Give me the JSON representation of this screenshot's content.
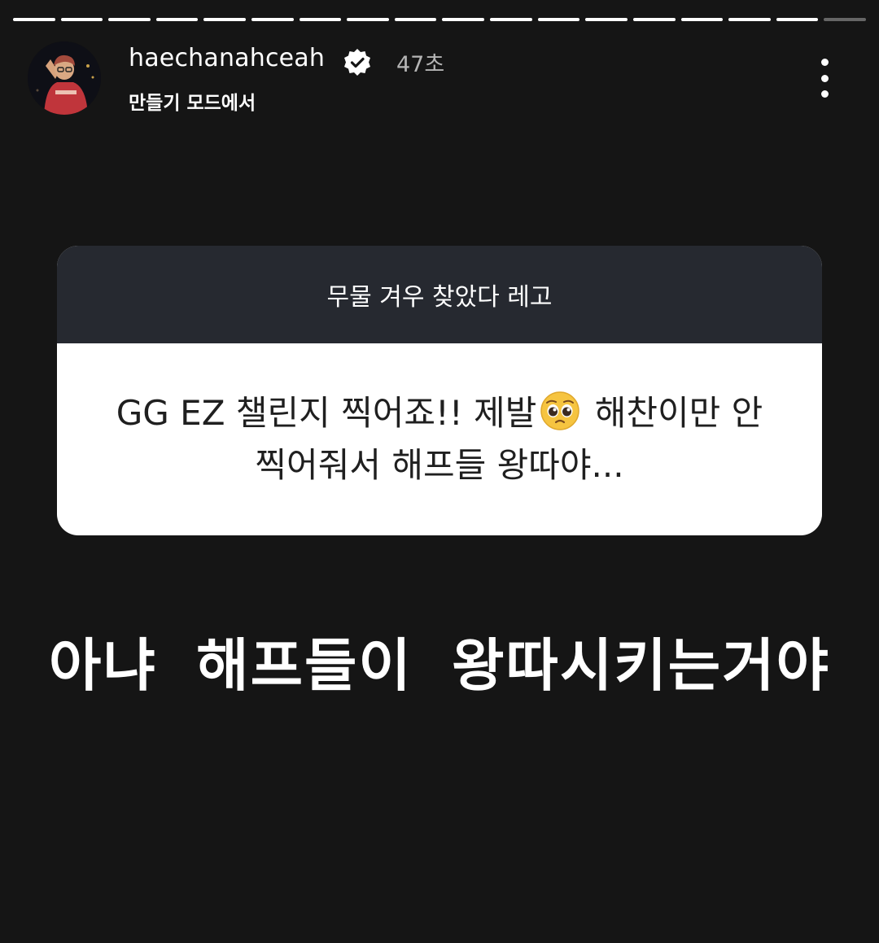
{
  "story": {
    "progress_segments": 18,
    "active_segment": 18
  },
  "header": {
    "username": "haechanahceah",
    "verified_icon": "verified-badge-icon",
    "time_ago": "47초",
    "subtitle": "만들기 모드에서",
    "more_icon": "more-vertical-icon"
  },
  "sticker": {
    "question": "무물 겨우 찾았다 레고",
    "answer_part1": "GG EZ 챌린지 찍어죠!! 제발",
    "answer_emoji": "pleading-face-emoji",
    "answer_part2": " 해찬이만 안 찍어줘서 해프들 왕따야...",
    "header_color": "#262930",
    "body_color": "#ffffff"
  },
  "caption": {
    "text": "아냐 해프들이 왕따시키는거야"
  },
  "colors": {
    "background": "#151515",
    "text": "#ffffff",
    "muted": "#b5b5b5"
  }
}
